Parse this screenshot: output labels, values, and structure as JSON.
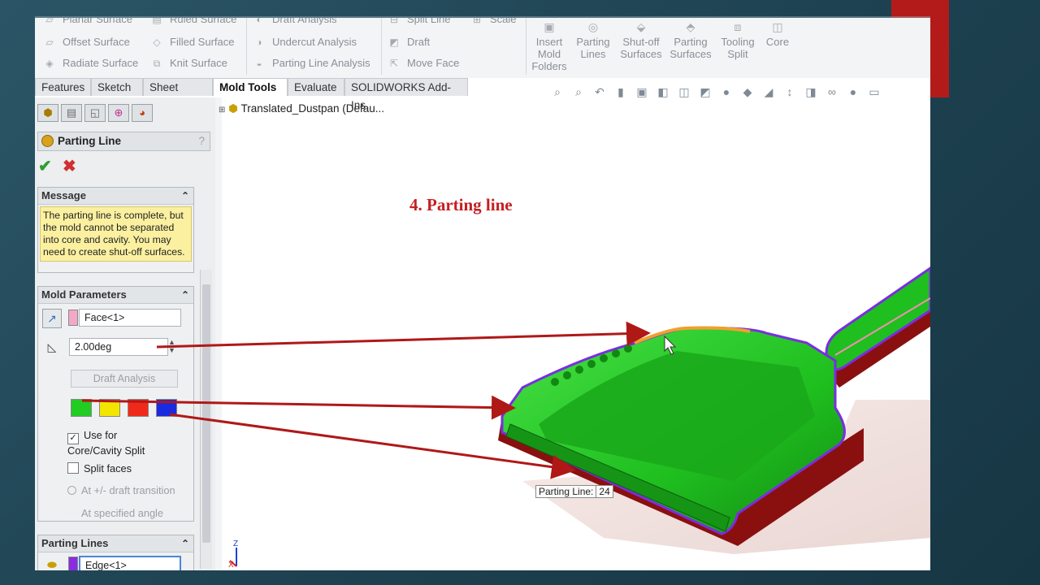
{
  "slide": {
    "title": "4. Parting line",
    "accent_color": "#b31b1b"
  },
  "ribbon": {
    "surface_items": [
      "Planar Surface",
      "Offset Surface",
      "Radiate Surface",
      "Ruled Surface",
      "Filled Surface",
      "Knit Surface"
    ],
    "analysis_items": [
      "Draft Analysis",
      "Undercut Analysis",
      "Parting Line Analysis"
    ],
    "face_items": [
      "Split Line",
      "Draft",
      "Move Face",
      "Scale"
    ],
    "big_buttons": [
      "Insert Mold Folders",
      "Parting Lines",
      "Shut-off Surfaces",
      "Parting Surfaces",
      "Tooling Split",
      "Core"
    ]
  },
  "tabs": [
    "Features",
    "Sketch",
    "Sheet Metal",
    "Mold Tools",
    "Evaluate",
    "SOLIDWORKS Add-Ins"
  ],
  "active_tab": "Mold Tools",
  "feature_tree": {
    "root": "Translated_Dustpan  (Defau..."
  },
  "property_manager": {
    "title": "Parting Line",
    "help": "?",
    "message_group": {
      "title": "Message",
      "text": "The parting line is complete, but the mold cannot be separated into core and cavity. You may need to create shut-off surfaces."
    },
    "mold_parameters": {
      "title": "Mold Parameters",
      "direction_face": "Face<1>",
      "draft_angle": "2.00deg",
      "draft_analysis_button": "Draft Analysis",
      "swatch_colors": [
        "#22cc22",
        "#f2e600",
        "#f02a1a",
        "#1a2ae0"
      ],
      "use_for_split_label": "Use for Core/Cavity Split",
      "use_for_split_checked": true,
      "split_faces_label": "Split faces",
      "split_faces_checked": false,
      "radio_transition": "At +/- draft transition",
      "radio_angle": "At specified angle"
    },
    "parting_lines": {
      "title": "Parting Lines",
      "edge": "Edge<1>"
    }
  },
  "viewport": {
    "tooltip_label": "Parting Line:",
    "tooltip_value": "24",
    "part_colors": {
      "cavity": "#1fbf1f",
      "core": "#8a1010",
      "parting": "#7a2ee0",
      "highlight": "#f0a030"
    }
  }
}
